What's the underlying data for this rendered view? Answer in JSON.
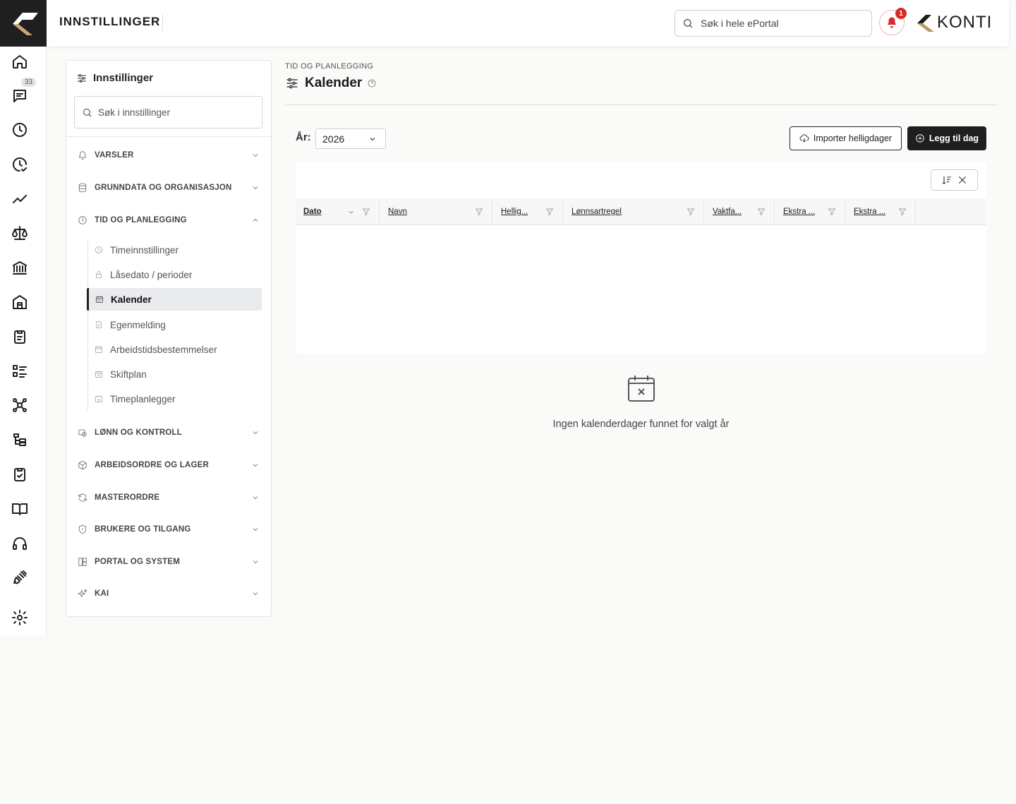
{
  "header": {
    "title": "INNSTILLINGER",
    "search_placeholder": "Søk i hele ePortal",
    "notification_count": "1",
    "brand_name": "KONTI"
  },
  "rail": {
    "messages_badge": "33",
    "items": [
      "home-icon",
      "messages-icon",
      "clock-icon",
      "clock-check-icon",
      "trend-icon",
      "scale-icon",
      "bank-icon",
      "building-icon",
      "clipboard-icon",
      "list-icon",
      "nodes-icon",
      "hierarchy-icon",
      "clipboard-check-icon",
      "book-icon",
      "headset-icon",
      "plug-icon",
      "settings-icon"
    ]
  },
  "settings": {
    "title": "Innstillinger",
    "search_placeholder": "Søk i innstillinger",
    "sections": [
      {
        "label": "VARSLER",
        "icon": "bell-icon"
      },
      {
        "label": "GRUNNDATA OG ORGANISASJON",
        "icon": "database-icon"
      },
      {
        "label": "TID OG PLANLEGGING",
        "icon": "clock-icon",
        "expanded": true
      },
      {
        "label": "LØNN OG KONTROLL",
        "icon": "payroll-icon"
      },
      {
        "label": "ARBEIDSORDRE OG LAGER",
        "icon": "box-icon"
      },
      {
        "label": "MASTERORDRE",
        "icon": "refresh-icon"
      },
      {
        "label": "BRUKERE OG TILGANG",
        "icon": "shield-icon"
      },
      {
        "label": "PORTAL OG SYSTEM",
        "icon": "layout-icon"
      },
      {
        "label": "KAI",
        "icon": "sparkle-icon"
      }
    ],
    "sub_items": [
      {
        "label": "Timeinnstillinger",
        "icon": "clock-icon"
      },
      {
        "label": "Låsedato / perioder",
        "icon": "lock-icon"
      },
      {
        "label": "Kalender",
        "icon": "calendar-icon",
        "active": true
      },
      {
        "label": "Egenmelding",
        "icon": "document-icon"
      },
      {
        "label": "Arbeidstidsbestemmelser",
        "icon": "calendar-rules-icon"
      },
      {
        "label": "Skiftplan",
        "icon": "calendar-check-icon"
      },
      {
        "label": "Timeplanlegger",
        "icon": "calendar-plus-icon"
      }
    ]
  },
  "content": {
    "breadcrumb": "TID OG PLANLEGGING",
    "title": "Kalender",
    "year_label": "År:",
    "year_value": "2026",
    "import_button": "Importer helligdager",
    "add_button": "Legg til dag",
    "columns": [
      "Dato",
      "Navn",
      "Hellig...",
      "Lønnsartregel",
      "Vaktfa...",
      "Ekstra ...",
      "Ekstra ..."
    ],
    "empty_message": "Ingen kalenderdager funnet for valgt år"
  },
  "colors": {
    "primary_dark": "#1f1f1f",
    "notification_red": "#d42b2b",
    "brand_gold": "#b9996a",
    "page_background": "#fafaf8"
  }
}
